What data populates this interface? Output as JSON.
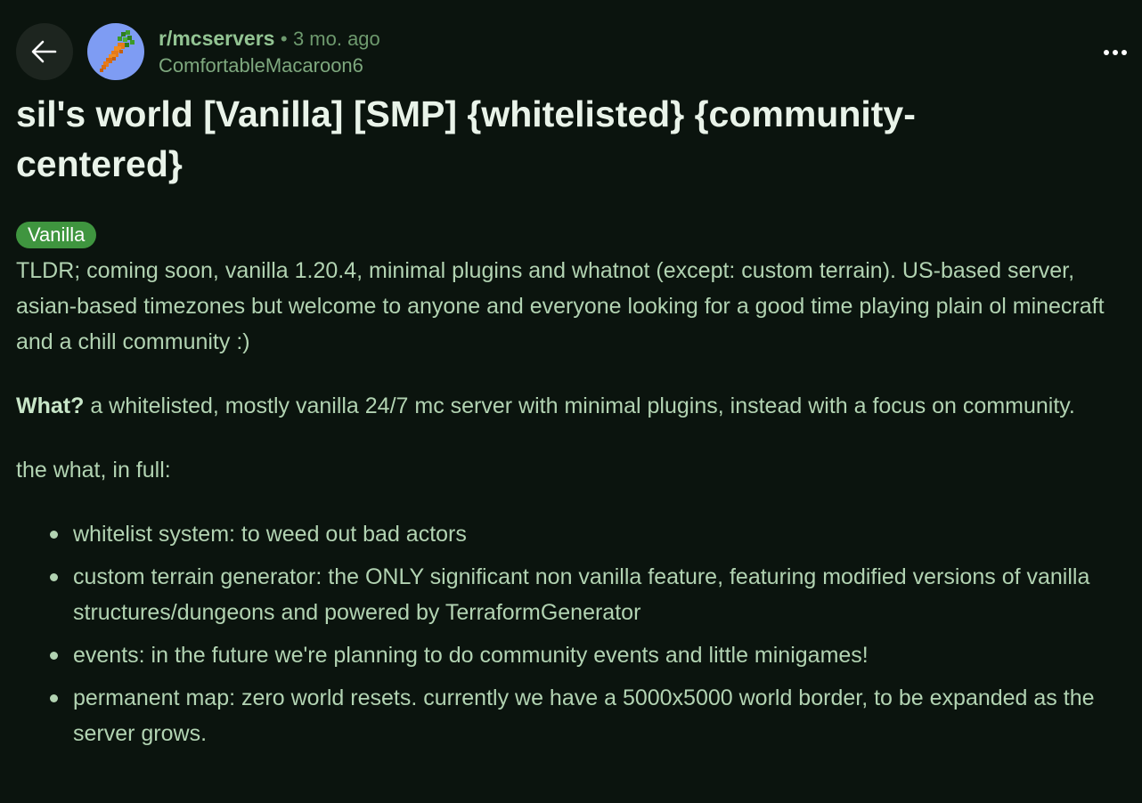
{
  "header": {
    "subreddit": "r/mcservers",
    "separator": "•",
    "age": "3 mo. ago",
    "author": "ComfortableMacaroon6",
    "avatar_icon": "carrot-icon",
    "back_icon": "arrow-left-icon",
    "more_icon": "more-horizontal-icon"
  },
  "post": {
    "title": "sil's world [Vanilla] [SMP] {whitelisted} {community-centered}",
    "flair": "Vanilla",
    "tldr": "TLDR; coming soon, vanilla 1.20.4, minimal plugins and whatnot (except: custom terrain). US-based server, asian-based timezones but welcome to anyone and everyone looking for a good time playing plain ol minecraft and a chill community :)",
    "what_label": "What?",
    "what_text": " a whitelisted, mostly vanilla 24/7 mc server with minimal plugins, instead with a focus on community.",
    "full_heading": "the what, in full:",
    "features": [
      "whitelist system: to weed out bad actors",
      "custom terrain generator: the ONLY significant non vanilla feature, featuring modified versions of vanilla structures/dungeons and powered by TerraformGenerator",
      "events: in the future we're planning to do community events and little minigames!",
      "permanent map: zero world resets. currently we have a 5000x5000 world border, to be expanded as the server grows."
    ]
  },
  "colors": {
    "background": "#0b140e",
    "text": "#b2d3b2",
    "title": "#e9f3e9",
    "flair_bg": "#3f953f",
    "avatar_bg": "#7e9cf3"
  }
}
